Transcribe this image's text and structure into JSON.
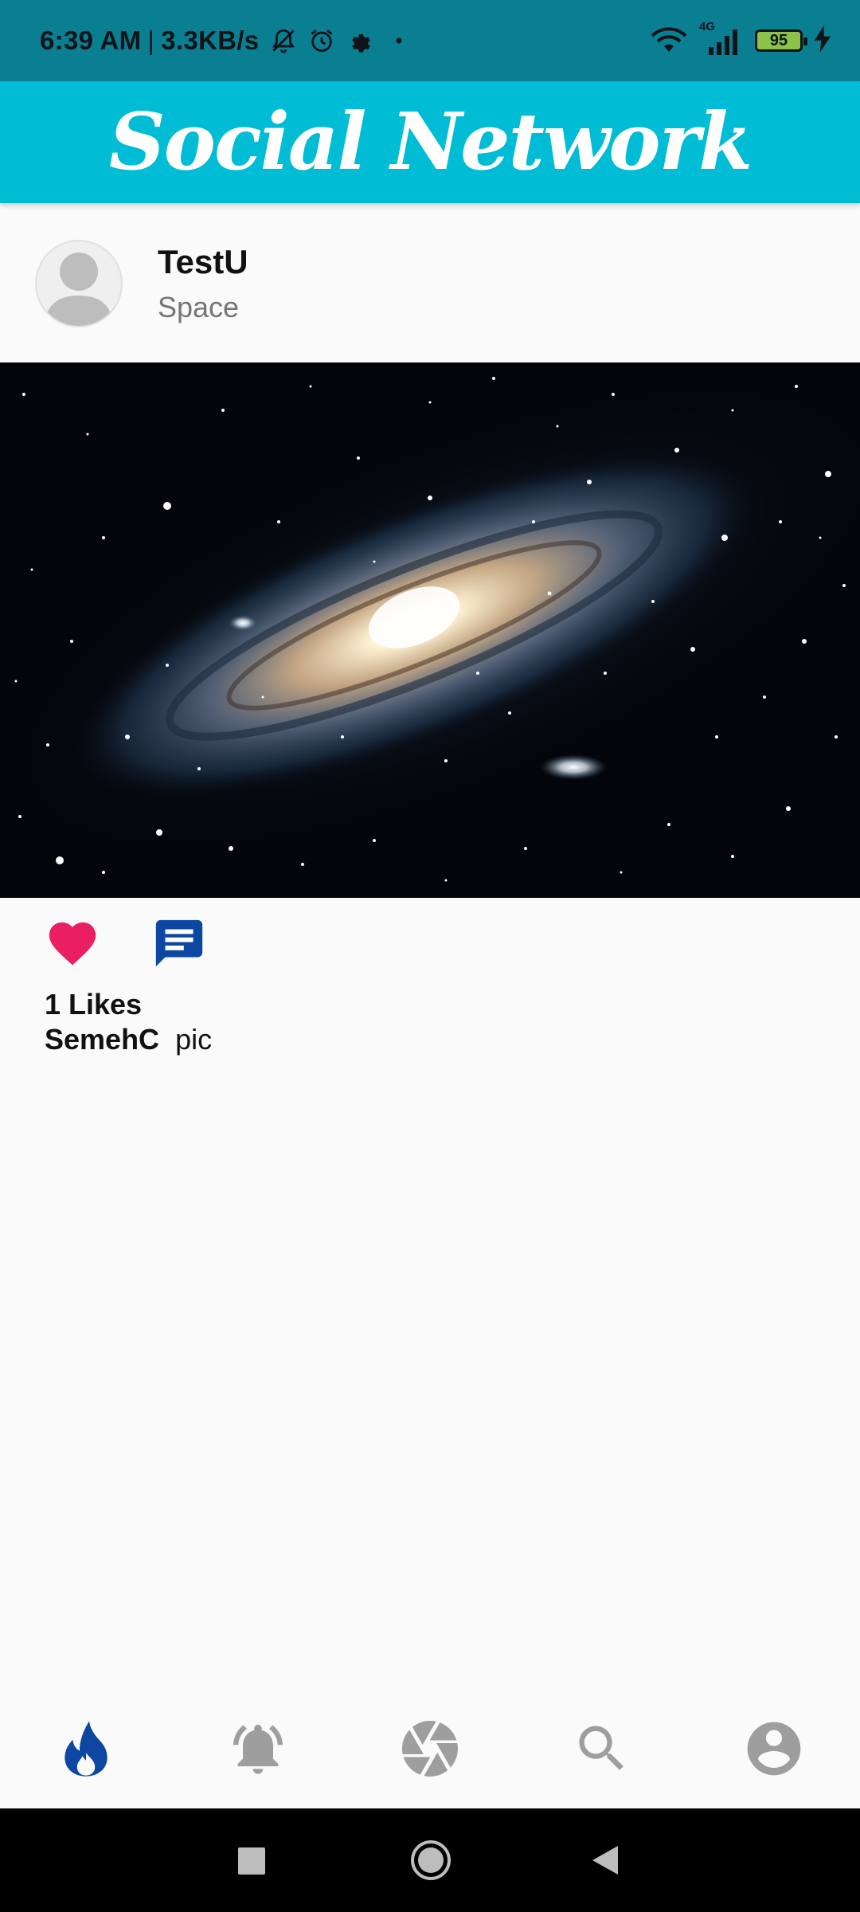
{
  "status_bar": {
    "time": "6:39 AM",
    "separator": "|",
    "net_speed": "3.3KB/s",
    "network_type": "4G",
    "battery_level": "95",
    "icons": [
      "bell-off-icon",
      "alarm-icon",
      "gear-icon",
      "dot-icon",
      "wifi-icon",
      "signal-icon",
      "battery-icon",
      "charging-icon"
    ]
  },
  "app_bar": {
    "title": "Social Network",
    "color": "#00bcd4"
  },
  "post": {
    "username": "TestU",
    "location": "Space",
    "image_alt": "galaxy",
    "likes_text": "1 Likes",
    "caption_author": "SemehC",
    "caption_text": "pic",
    "like_color": "#e91e63",
    "comment_color": "#0d47a1"
  },
  "bottom_nav": {
    "items": [
      {
        "name": "home-icon",
        "active": true
      },
      {
        "name": "notifications-icon",
        "active": false
      },
      {
        "name": "camera-icon",
        "active": false
      },
      {
        "name": "search-icon",
        "active": false
      },
      {
        "name": "profile-icon",
        "active": false
      }
    ],
    "active_color": "#0d47a1",
    "inactive_color": "#9e9e9e"
  },
  "system_nav": [
    "recents-icon",
    "home-circle-icon",
    "back-icon"
  ]
}
